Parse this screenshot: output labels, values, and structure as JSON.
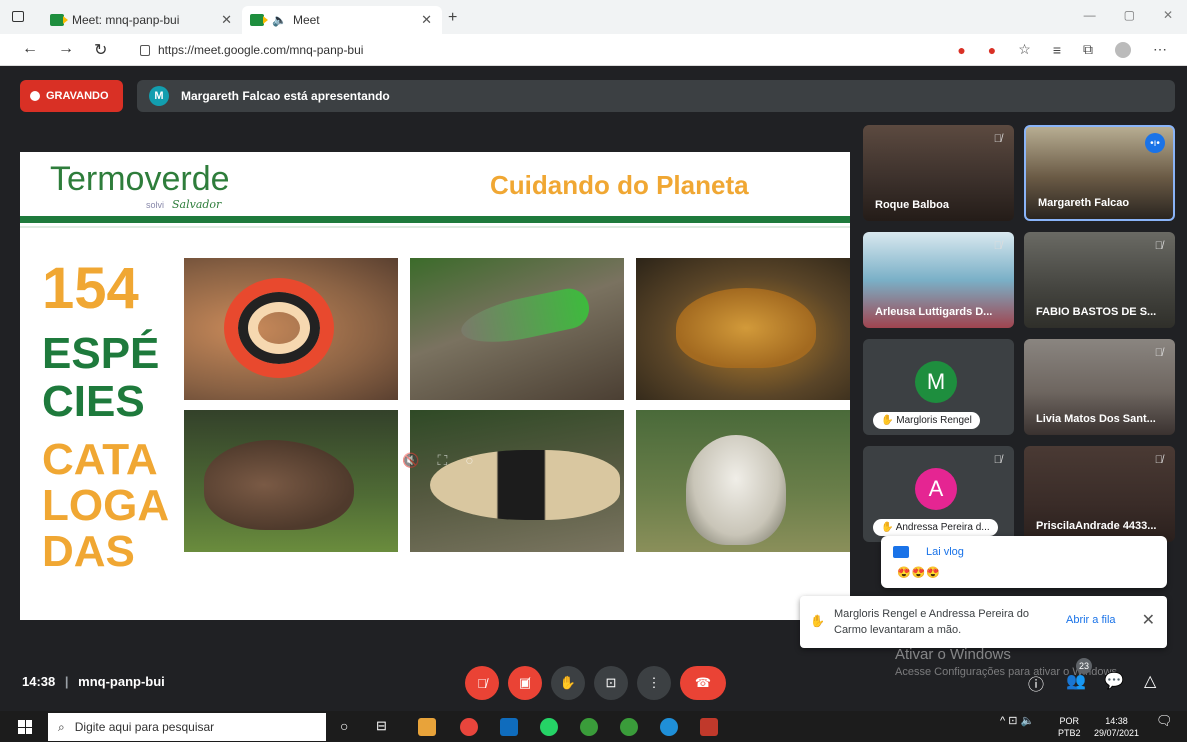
{
  "browser": {
    "tabs": [
      {
        "title": "Meet: mnq-panp-bui"
      },
      {
        "title": "Meet"
      }
    ],
    "url": "https://meet.google.com/mnq-panp-bui"
  },
  "meet": {
    "recording_label": "GRAVANDO",
    "presenter_avatar": "M",
    "presenting_text": "Margareth Falcao está apresentando",
    "slide": {
      "logo": "Termoverde",
      "logo_sub1": "solvi",
      "logo_sub2": "Salvador",
      "title": "Cuidando do Planeta",
      "count": "154",
      "line1": "ESPÉ",
      "line2": "CIES",
      "line3": "CATA",
      "line4": "LOGA",
      "line5": "DAS"
    },
    "participants": [
      {
        "name": "Roque Balboa"
      },
      {
        "name": "Margareth Falcao"
      },
      {
        "name": "Arleusa Luttigards D..."
      },
      {
        "name": "FABIO BASTOS DE S..."
      },
      {
        "name": "Margloris Rengel",
        "initial": "M",
        "color": "#1e8e3e"
      },
      {
        "name": "Livia Matos Dos Sant..."
      },
      {
        "name": "Andressa Pereira d...",
        "initial": "A",
        "color": "#e52592"
      },
      {
        "name": "PriscilaAndrade 4433..."
      }
    ],
    "chat_popup": {
      "sender": "Lai vlog",
      "message": "😍😍😍"
    },
    "notification": {
      "text": "Margloris Rengel e Andressa Pereira do Carmo levantaram a mão.",
      "action": "Abrir a fila"
    },
    "watermark_title": "Ativar o Windows",
    "watermark_sub": "Acesse Configurações para ativar o Windows.",
    "clock": "14:38",
    "meeting_code": "mnq-panp-bui",
    "participant_count": "23"
  },
  "taskbar": {
    "search_placeholder": "Digite aqui para pesquisar",
    "lang": "POR",
    "layout": "PTB2",
    "time": "14:38",
    "date": "29/07/2021"
  }
}
